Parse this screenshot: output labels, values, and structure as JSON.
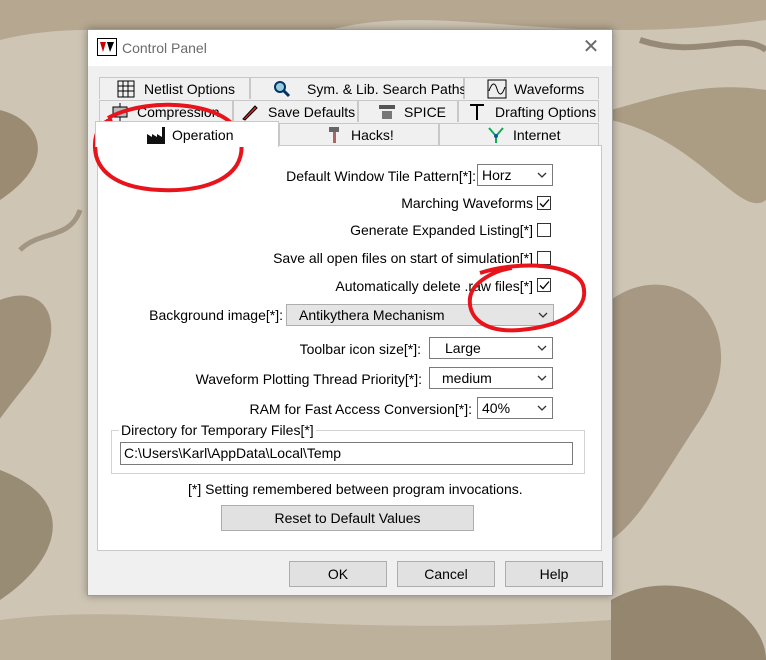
{
  "window": {
    "title": "Control Panel",
    "close_glyph": "✕"
  },
  "tabs": {
    "row1": [
      {
        "label": "Netlist Options",
        "icon": "netlist-icon"
      },
      {
        "label": "Sym. & Lib. Search Paths",
        "icon": "magnifier-icon"
      },
      {
        "label": "Waveforms",
        "icon": "waveform-icon"
      }
    ],
    "row2": [
      {
        "label": "Compression",
        "icon": "compression-icon"
      },
      {
        "label": "Save Defaults",
        "icon": "pen-icon"
      },
      {
        "label": "SPICE",
        "icon": "spice-icon"
      },
      {
        "label": "Drafting Options",
        "icon": "drafting-icon"
      }
    ],
    "row3": [
      {
        "label": "Operation",
        "icon": "factory-icon"
      },
      {
        "label": "Hacks!",
        "icon": "hammer-icon"
      },
      {
        "label": "Internet",
        "icon": "network-icon"
      }
    ]
  },
  "operation": {
    "tile_label": "Default Window Tile Pattern[*]:",
    "tile_value": "Horz",
    "marching_label": "Marching Waveforms",
    "marching_checked": true,
    "expanded_label": "Generate Expanded Listing[*]",
    "expanded_checked": false,
    "saveall_label": "Save all open files on start of simulation[*]",
    "saveall_checked": false,
    "autodelete_label": "Automatically delete .raw files[*]",
    "autodelete_checked": true,
    "background_label": "Background image[*]:",
    "background_value": "Antikythera Mechanism",
    "iconsize_label": "Toolbar icon size[*]:",
    "iconsize_value": "Large",
    "priority_label": "Waveform Plotting Thread Priority[*]:",
    "priority_value": "medium",
    "ram_label": "RAM for Fast Access Conversion[*]:",
    "ram_value": "40%",
    "tempdir_group": "Directory for Temporary Files[*]",
    "tempdir_value": "C:\\Users\\Karl\\AppData\\Local\\Temp",
    "note": "[*] Setting remembered between program invocations.",
    "reset_label": "Reset to Default Values"
  },
  "buttons": {
    "ok": "OK",
    "cancel": "Cancel",
    "help": "Help"
  },
  "colors": {
    "annotation": "#e8141c",
    "dialog_bg": "#f0f0f0"
  }
}
